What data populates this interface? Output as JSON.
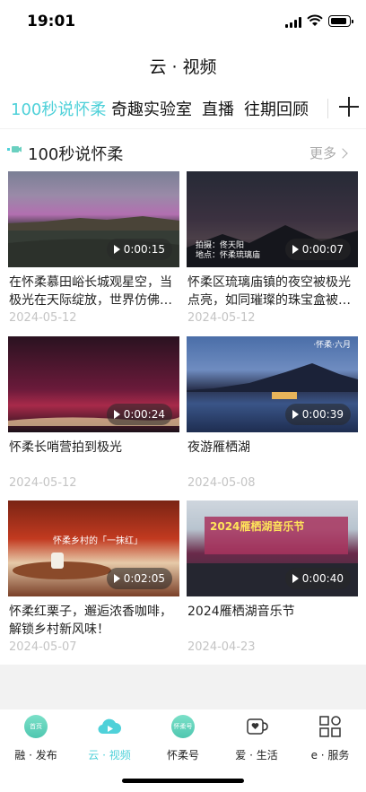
{
  "status_bar": {
    "time": "19:01"
  },
  "page": {
    "title": "云 · 视频"
  },
  "tabs": [
    {
      "label": "100秒说怀柔",
      "active": true
    },
    {
      "label": "奇趣实验室",
      "active": false
    },
    {
      "label": "直播",
      "active": false
    },
    {
      "label": "往期回顾",
      "active": false
    }
  ],
  "section": {
    "title": "100秒说怀柔",
    "more": "更多"
  },
  "videos": [
    {
      "title": "在怀柔慕田峪长城观星空，当极光在天际绽放，世界仿佛…",
      "date": "2024-05-12",
      "duration": "0:00:15"
    },
    {
      "title": "怀柔区琉璃庙镇的夜空被极光点亮，如同璀璨的珠宝盒被…",
      "date": "2024-05-12",
      "duration": "0:00:07",
      "overlay": "拍摄：佟天阳\n地点：怀柔琉璃庙"
    },
    {
      "title": "怀柔长哨营拍到极光",
      "date": "2024-05-12",
      "duration": "0:00:24"
    },
    {
      "title": "夜游雁栖湖",
      "date": "2024-05-08",
      "duration": "0:00:39",
      "overlay": "·怀柔·六月"
    },
    {
      "title": "怀柔红栗子，邂逅浓香咖啡，解锁乡村新风味！",
      "date": "2024-05-07",
      "duration": "0:02:05",
      "overlay": "怀柔乡村的「一抹红」"
    },
    {
      "title": "2024雁栖湖音乐节",
      "date": "2024-04-23",
      "duration": "0:00:40",
      "overlay": "2024雁栖湖音乐节"
    }
  ],
  "bottom_nav": [
    {
      "label": "融 · 发布",
      "icon": "publish-icon",
      "badge": "首页"
    },
    {
      "label": "云 · 视频",
      "icon": "video-cloud-icon",
      "active": true
    },
    {
      "label": "怀柔号",
      "icon": "huairou-hao-icon",
      "badge": "怀柔号"
    },
    {
      "label": "爱 · 生活",
      "icon": "life-heart-icon"
    },
    {
      "label": "e · 服务",
      "icon": "service-grid-icon"
    }
  ],
  "colors": {
    "accent": "#4fd1d9",
    "muted": "#c4c4c4",
    "divider": "#f2f2f2"
  }
}
